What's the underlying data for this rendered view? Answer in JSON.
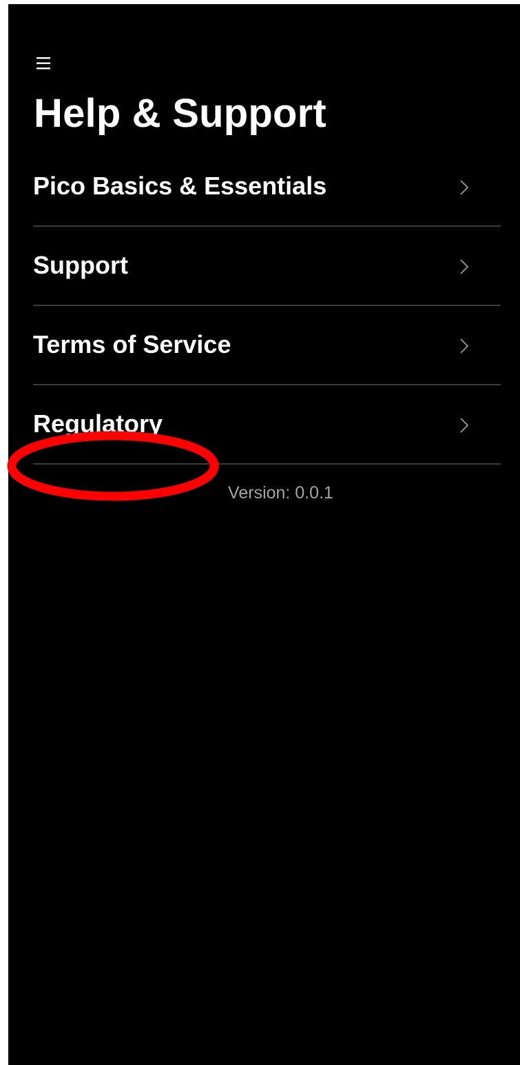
{
  "header": {
    "menu_icon": "hamburger-menu-icon",
    "title": "Help & Support"
  },
  "menu": {
    "items": [
      {
        "label": "Pico Basics & Essentials",
        "icon": "chevron-right-icon"
      },
      {
        "label": "Support",
        "icon": "chevron-right-icon"
      },
      {
        "label": "Terms of Service",
        "icon": "chevron-right-icon"
      },
      {
        "label": "Regulatory",
        "icon": "chevron-right-icon"
      }
    ]
  },
  "footer": {
    "version": "Version: 0.0.1"
  },
  "colors": {
    "background": "#000000",
    "text": "#ffffff",
    "divider": "#3b3b3b",
    "muted_text": "#a3a3a3",
    "annotation": "#ff0000"
  }
}
